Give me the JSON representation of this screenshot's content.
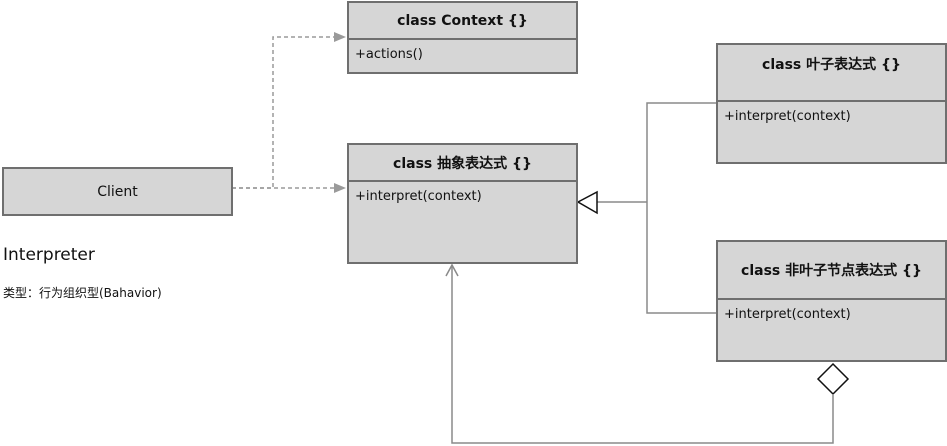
{
  "diagram": {
    "pattern_name": "Interpreter",
    "pattern_type": "类型：行为组织型(Bahavior)",
    "client": {
      "label": "Client"
    },
    "context_class": {
      "title": "class Context {}",
      "members": [
        "+actions()"
      ]
    },
    "abstract_expression_class": {
      "title": "class 抽象表达式 {}",
      "members": [
        "+interpret(context)"
      ]
    },
    "terminal_expression_class": {
      "title": "class 叶子表达式 {}",
      "members": [
        "+interpret(context)"
      ]
    },
    "nonterminal_expression_class": {
      "title": "class 非叶子节点表达式 {}",
      "members": [
        "+interpret(context)"
      ]
    },
    "relationships": [
      {
        "from": "Client",
        "to": "Context",
        "kind": "dependency"
      },
      {
        "from": "Client",
        "to": "抽象表达式",
        "kind": "dependency"
      },
      {
        "from": "叶子表达式",
        "to": "抽象表达式",
        "kind": "generalization"
      },
      {
        "from": "非叶子节点表达式",
        "to": "抽象表达式",
        "kind": "generalization"
      },
      {
        "from": "非叶子节点表达式",
        "to": "抽象表达式",
        "kind": "aggregation"
      }
    ],
    "colors": {
      "box_fill": "#d6d6d6",
      "box_border": "#6f6f6f",
      "line": "#8a8a8a",
      "dashed_line": "#9a9a9a"
    }
  }
}
